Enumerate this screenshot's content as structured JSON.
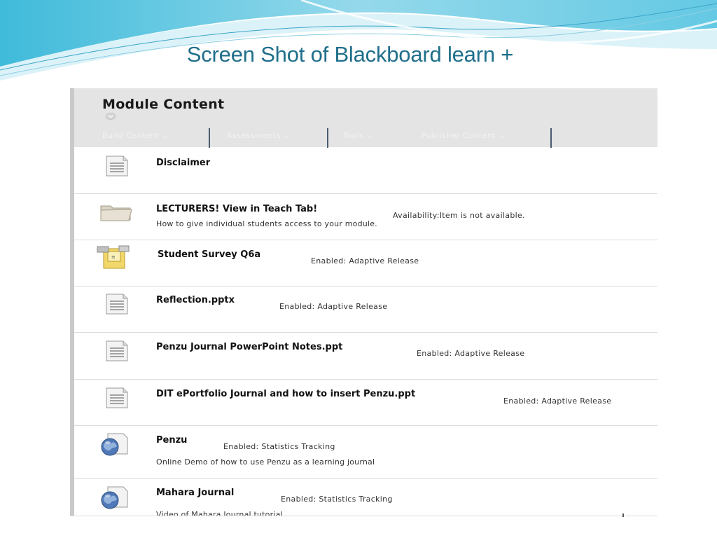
{
  "slide": {
    "title": "Screen Shot of Blackboard learn +"
  },
  "module": {
    "title": "Module  Content",
    "toolbar": [
      {
        "label": "Build Content"
      },
      {
        "label": "Assessments"
      },
      {
        "label": "Tools"
      },
      {
        "label": "Publisher Content"
      }
    ]
  },
  "items": [
    {
      "title": "Disclaimer",
      "status": "",
      "description": "",
      "icon": "document-icon"
    },
    {
      "title": "LECTURERS!  View in Teach Tab!",
      "status": "Availability:Item is not available.",
      "description": "How to give individual students access to your module.",
      "icon": "folder-icon"
    },
    {
      "title": "Student Survey Q6a",
      "status": "Enabled:  Adaptive Release",
      "description": "",
      "icon": "survey-icon"
    },
    {
      "title": "Reflection.pptx",
      "status": "Enabled:  Adaptive Release",
      "description": "",
      "icon": "document-icon"
    },
    {
      "title": "Penzu Journal PowerPoint Notes.ppt",
      "status": "Enabled:  Adaptive Release",
      "description": "",
      "icon": "document-icon"
    },
    {
      "title": "DIT ePortfolio Journal and how to insert Penzu.ppt",
      "status": "Enabled:  Adaptive Release",
      "description": "",
      "icon": "document-icon"
    },
    {
      "title": "Penzu",
      "status": "Enabled:  Statistics Tracking",
      "description": "Online Demo of how to use Penzu as a learning journal",
      "icon": "web-link-icon"
    },
    {
      "title": "Mahara Journal",
      "status": "Enabled:  Statistics Tracking",
      "description": "Video of Mahara  Journal tutorial",
      "icon": "web-link-icon"
    }
  ],
  "colors": {
    "title": "#1f6f8b",
    "header_bg": "#e4e4e4",
    "separator": "#4a5a70"
  }
}
